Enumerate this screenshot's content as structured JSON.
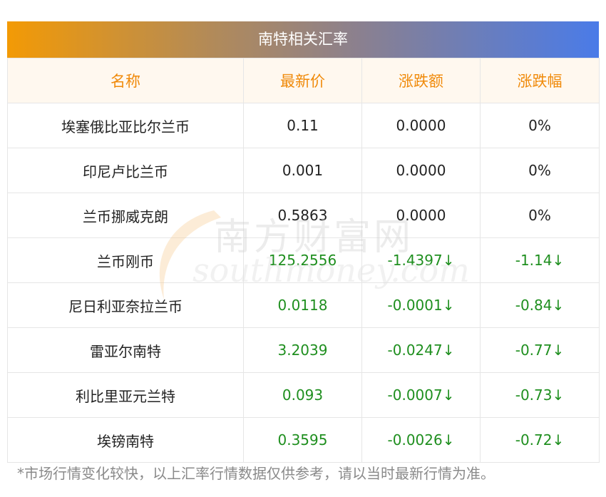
{
  "title": "南特相关汇率",
  "headers": [
    "名称",
    "最新价",
    "涨跌额",
    "涨跌幅"
  ],
  "rows": [
    {
      "name": "埃塞俄比亚比尔兰币",
      "price": "0.11",
      "change": "0.0000",
      "pct": "0%",
      "trend": "flat"
    },
    {
      "name": "印尼卢比兰币",
      "price": "0.001",
      "change": "0.0000",
      "pct": "0%",
      "trend": "flat"
    },
    {
      "name": "兰币挪威克朗",
      "price": "0.5863",
      "change": "0.0000",
      "pct": "0%",
      "trend": "flat"
    },
    {
      "name": "兰币刚币",
      "price": "125.2556",
      "change": "-1.4397↓",
      "pct": "-1.14↓",
      "trend": "down"
    },
    {
      "name": "尼日利亚奈拉兰币",
      "price": "0.0118",
      "change": "-0.0001↓",
      "pct": "-0.84↓",
      "trend": "down"
    },
    {
      "name": "雷亚尔南特",
      "price": "3.2039",
      "change": "-0.0247↓",
      "pct": "-0.77↓",
      "trend": "down"
    },
    {
      "name": "利比里亚元兰特",
      "price": "0.093",
      "change": "-0.0007↓",
      "pct": "-0.73↓",
      "trend": "down"
    },
    {
      "name": "埃镑南特",
      "price": "0.3595",
      "change": "-0.0026↓",
      "pct": "-0.72↓",
      "trend": "down"
    }
  ],
  "note": "*市场行情变化较快，以上汇率行情数据仅供参考，请以当时最新行情为准。",
  "watermark": {
    "cn": "南方财富网",
    "en": "southmoney.com"
  },
  "colors": {
    "header_text": "#f08a0a",
    "down": "#1f8f1f",
    "gradient_start": "#f39a05",
    "gradient_end": "#4a7be8"
  }
}
